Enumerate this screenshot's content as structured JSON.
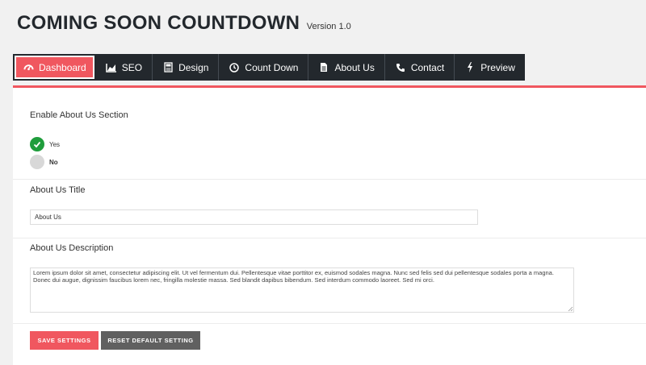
{
  "header": {
    "title": "COMING SOON COUNTDOWN",
    "version": "Version 1.0"
  },
  "tabs": [
    {
      "label": "Dashboard",
      "icon": "dashboard-icon"
    },
    {
      "label": "SEO",
      "icon": "chart-icon"
    },
    {
      "label": "Design",
      "icon": "design-icon"
    },
    {
      "label": "Count Down",
      "icon": "clock-icon"
    },
    {
      "label": "About Us",
      "icon": "document-icon"
    },
    {
      "label": "Contact",
      "icon": "phone-icon"
    },
    {
      "label": "Preview",
      "icon": "bolt-icon"
    }
  ],
  "active_tab": "Dashboard",
  "colors": {
    "accent": "#f0575f",
    "tab_bg": "#23282d",
    "radio_on": "#1f9d3c",
    "reset_button": "#606060"
  },
  "enable_section": {
    "label": "Enable About Us Section",
    "options": [
      {
        "label": "Yes",
        "selected": true
      },
      {
        "label": "No",
        "selected": false
      }
    ]
  },
  "title_field": {
    "label": "About Us Title",
    "value": "About Us"
  },
  "description_field": {
    "label": "About Us Description",
    "value": "Lorem ipsum dolor sit amet, consectetur adipiscing elit. Ut vel fermentum dui. Pellentesque vitae porttitor ex, euismod sodales magna. Nunc sed felis sed dui pellentesque sodales porta a magna. Donec dui augue, dignissim faucibus lorem nec, fringilla molestie massa. Sed blandit dapibus bibendum. Sed interdum commodo laoreet. Sed mi orci."
  },
  "buttons": {
    "save": "SAVE SETTINGS",
    "reset": "RESET DEFAULT SETTING"
  }
}
